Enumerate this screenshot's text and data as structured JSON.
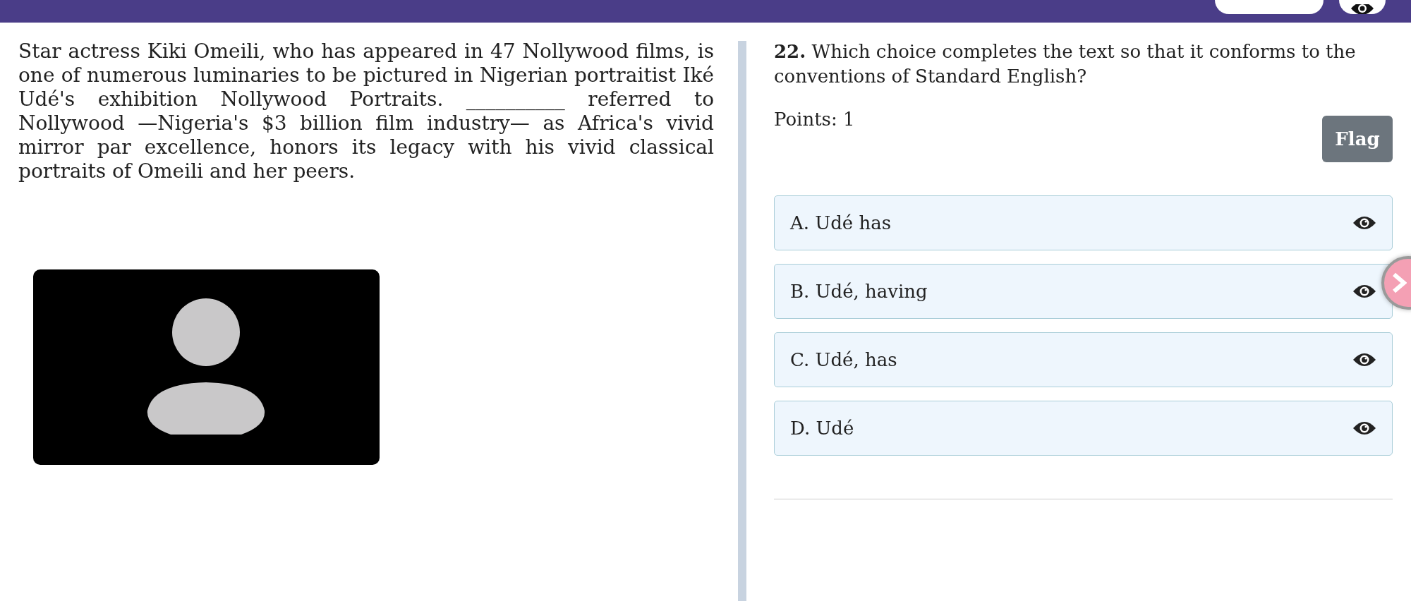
{
  "passage": {
    "text": "Star actress Kiki Omeili, who has appeared in 47 Nollywood films, is one of numerous luminaries to be pictured in Nigerian portraitist Iké Udé's exhibition Nollywood Portraits. __________ referred to Nollywood —Nigeria's $3 billion film industry— as Africa's vivid mirror par excellence, honors its legacy with his vivid classical portraits of Omeili and her peers."
  },
  "question": {
    "prompt": "**22.** Which choice completes the text so that it conforms to the conventions of Standard English?",
    "points": "Points: 1",
    "flag_button": "Flag"
  },
  "options": [
    {
      "label": "A. Udé has"
    },
    {
      "label": "B. Udé, having"
    },
    {
      "label": "C. Udé, has"
    },
    {
      "label": "D. Udé"
    }
  ]
}
